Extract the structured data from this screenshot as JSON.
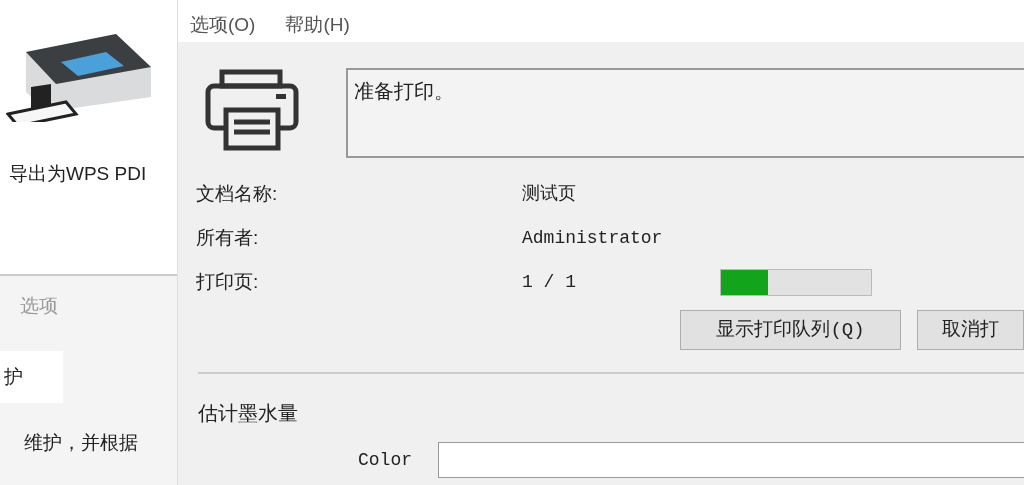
{
  "background_window": {
    "printer_name": "导出为WPS PDI",
    "section_heading": "选项",
    "tab": {
      "label": "护"
    },
    "description": "维护，并根据"
  },
  "dialog": {
    "menu": [
      {
        "label": "选项(O)"
      },
      {
        "label": "帮助(H)"
      }
    ],
    "status": "准备打印。",
    "fields": [
      {
        "label": "文档名称:",
        "value": "测试页"
      },
      {
        "label": "所有者:",
        "value": "Administrator"
      },
      {
        "label": "打印页:",
        "value": "1 / 1",
        "level": 0.31
      }
    ],
    "buttons": [
      {
        "label": "显示打印队列(Q)"
      },
      {
        "label": "取消打"
      }
    ],
    "ink_heading": "估计墨水量",
    "ink": [
      {
        "label": "Color"
      }
    ]
  }
}
